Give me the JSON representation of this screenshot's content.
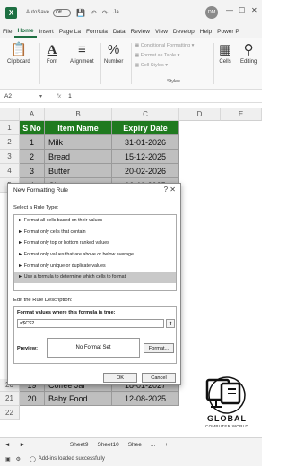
{
  "titlebar": {
    "autosave_label": "AutoSave",
    "autosave_state": "Off",
    "filename": "Ja...",
    "user_initials": "DM",
    "minimize": "—",
    "maximize": "☐",
    "close": "✕"
  },
  "ribbon_tabs": [
    "File",
    "Home",
    "Insert",
    "Page La",
    "Formula",
    "Data",
    "Review",
    "View",
    "Develop",
    "Help",
    "Power P"
  ],
  "ribbon": {
    "clipboard": "Clipboard",
    "font": "Font",
    "alignment": "Alignment",
    "number": "Number",
    "conditional_formatting": "Conditional Formatting",
    "format_as_table": "Format as Table",
    "cell_styles": "Cell Styles",
    "styles_group": "Styles",
    "cells": "Cells",
    "editing": "Editing"
  },
  "formula_bar": {
    "name_box": "A2",
    "fx": "fx",
    "value": "1"
  },
  "columns": [
    "A",
    "B",
    "C",
    "D",
    "E"
  ],
  "table_header": {
    "sno": "S No",
    "item": "Item Name",
    "expiry": "Expiry Date"
  },
  "visible_rows": [
    {
      "row": "1"
    },
    {
      "row": "2",
      "sno": "1",
      "item": "Milk",
      "expiry": "31-01-2026"
    },
    {
      "row": "3",
      "sno": "2",
      "item": "Bread",
      "expiry": "15-12-2025"
    },
    {
      "row": "4",
      "sno": "3",
      "item": "Butter",
      "expiry": "20-02-2026"
    },
    {
      "row": "5",
      "sno": "4",
      "item": "Ch...",
      "expiry": "10-11-2025"
    }
  ],
  "bottom_rows": [
    {
      "row": "20",
      "sno": "19",
      "item": "Coffee Jar",
      "expiry": "18-01-2027"
    },
    {
      "row": "21",
      "sno": "20",
      "item": "Baby Food",
      "expiry": "12-08-2025"
    },
    {
      "row": "22"
    }
  ],
  "dialog": {
    "title": "New Formatting Rule",
    "close": "?  ✕",
    "select_rule_type": "Select a Rule Type:",
    "rule_types": [
      "► Format all cells based on their values",
      "► Format only cells that contain",
      "► Format only top or bottom ranked values",
      "► Format only values that are above or below average",
      "► Format only unique or duplicate values",
      "► Use a formula to determine which cells to format"
    ],
    "selected_index": 5,
    "edit_rule_description": "Edit the Rule Description:",
    "formula_label": "Format values where this formula is true:",
    "formula_value": "=$C$2",
    "preview_label": "Preview:",
    "preview_text": "No Format Set",
    "format_button": "Format...",
    "ok_button": "OK",
    "cancel_button": "Cancel"
  },
  "logo": {
    "title": "GLOBAL",
    "subtitle": "COMPUTER WORLD"
  },
  "sheet_tabs": {
    "prev": "◄",
    "next": "►",
    "sheets": [
      "Sheet9",
      "Sheet10",
      "Shee"
    ],
    "more": "...",
    "add": "+"
  },
  "status": {
    "message": "Add-ins loaded successfully"
  },
  "colors": {
    "excel_green": "#1d6f42",
    "header_green": "#1f7a1f",
    "row_gray": "#bfbfbf"
  }
}
